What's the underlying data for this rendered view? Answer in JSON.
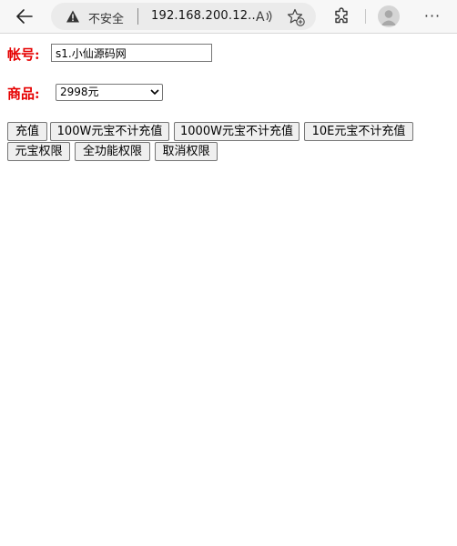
{
  "browser": {
    "back_icon": "arrow-left-icon",
    "security_label": "不安全",
    "url": "192.168.200.12...",
    "read_aloud_icon": "read-aloud-icon",
    "favorites_icon": "add-favorite-icon",
    "extensions_icon": "extensions-icon",
    "profile_icon": "profile-avatar-icon",
    "more_icon": "more-icon",
    "more_glyph": "···"
  },
  "form": {
    "account_label": "帐号:",
    "account_value": "s1.小仙源码网",
    "product_label": "商品:",
    "product_selected": "2998元",
    "label_color": "#e60000"
  },
  "buttons": {
    "recharge": "充值",
    "yb_100w": "100W元宝不计充值",
    "yb_1000w": "1000W元宝不计充值",
    "yb_10e": "10E元宝不计充值",
    "yb_permission": "元宝权限",
    "full_permission": "全功能权限",
    "cancel_permission": "取消权限"
  }
}
